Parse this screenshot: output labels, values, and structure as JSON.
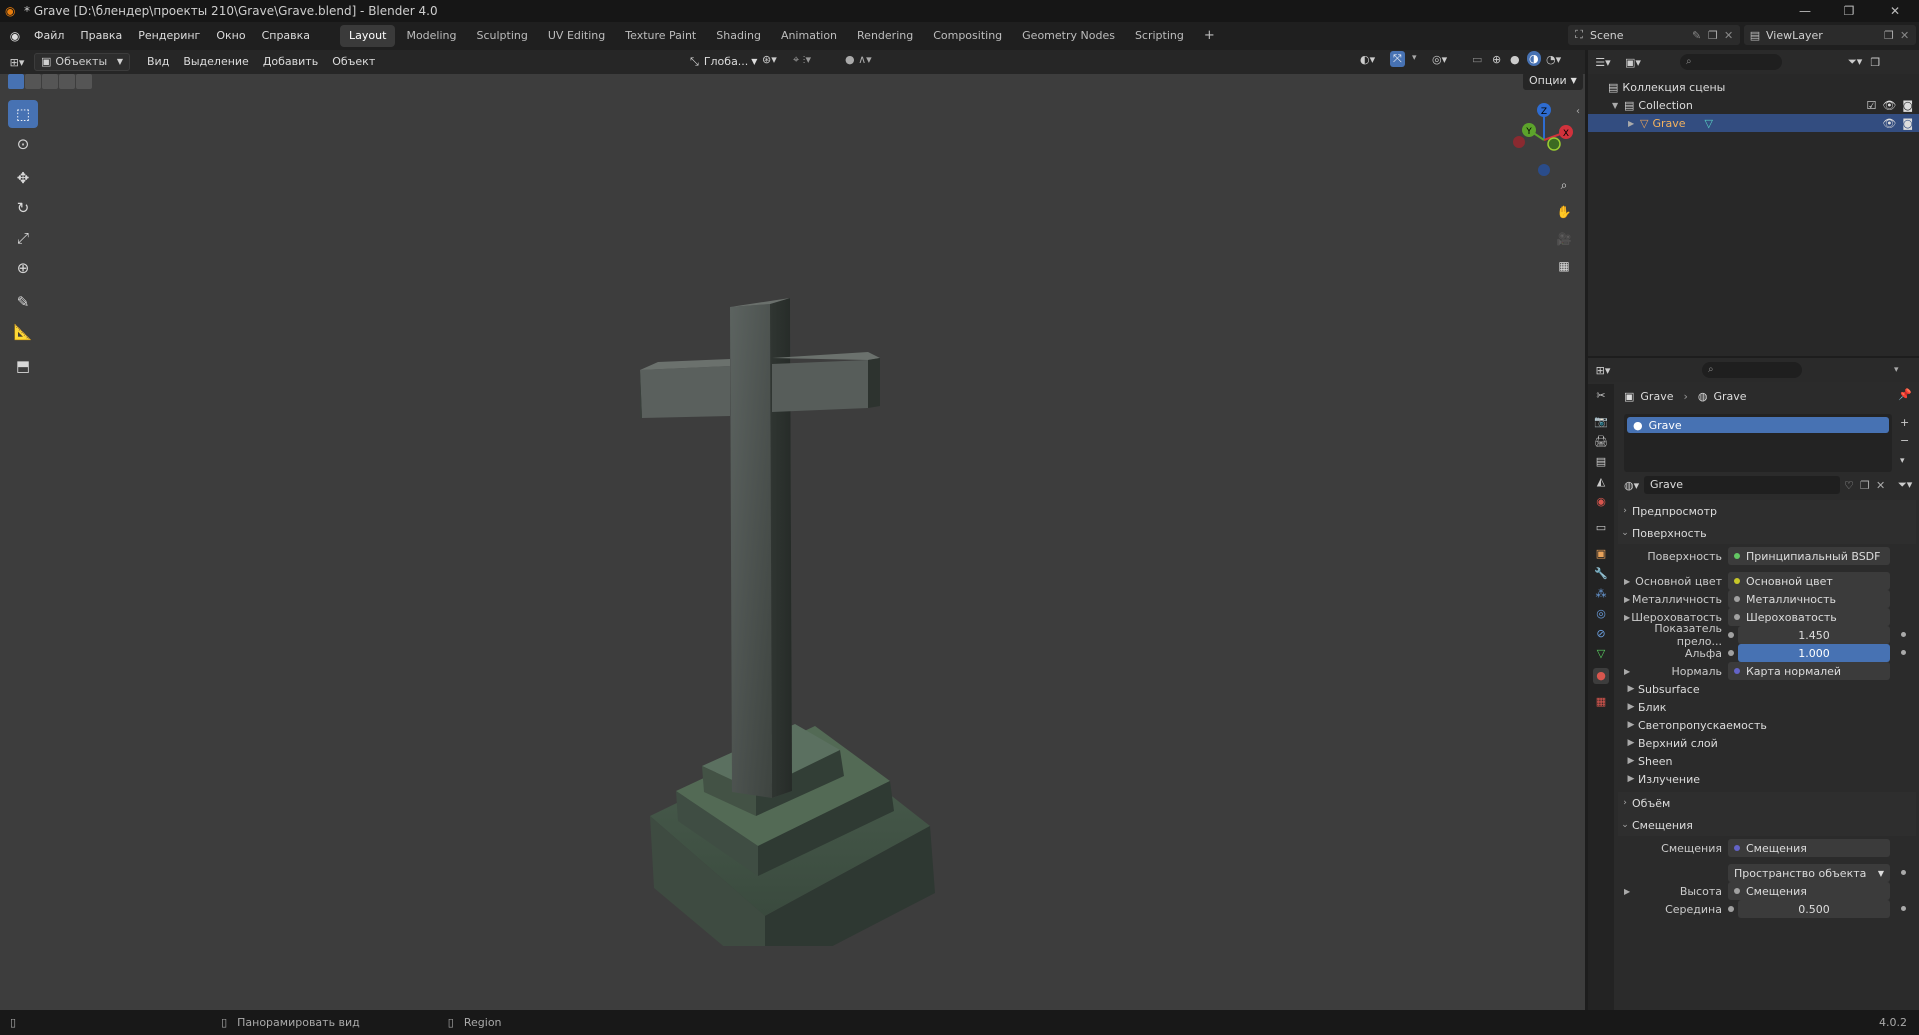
{
  "window": {
    "title": "* Grave [D:\\блендер\\проекты 210\\Grave\\Grave.blend] - Blender 4.0"
  },
  "menu": [
    "Файл",
    "Правка",
    "Рендеринг",
    "Окно",
    "Справка"
  ],
  "workspaces": [
    "Layout",
    "Modeling",
    "Sculpting",
    "UV Editing",
    "Texture Paint",
    "Shading",
    "Animation",
    "Rendering",
    "Compositing",
    "Geometry Nodes",
    "Scripting"
  ],
  "active_workspace": "Layout",
  "scene": {
    "name": "Scene",
    "view_layer": "ViewLayer"
  },
  "viewport_header": {
    "mode": "Объекты",
    "menus": [
      "Вид",
      "Выделение",
      "Добавить",
      "Объект"
    ],
    "orientation": "Глоба...",
    "options": "Опции"
  },
  "outliner": {
    "scene_collection": "Коллекция сцены",
    "collection": "Collection",
    "object": "Grave"
  },
  "properties": {
    "breadcrumb_object": "Grave",
    "breadcrumb_material": "Grave",
    "slot_name": "Grave",
    "material_name": "Grave",
    "panels": {
      "preview": "Предпросмотр",
      "surface": "Поверхность",
      "volume": "Объём",
      "displacement": "Смещения"
    },
    "rows": {
      "surface_label": "Поверхность",
      "surface_value": "Принципиальный BSDF",
      "base_color_label": "Основной цвет",
      "base_color_value": "Основной цвет",
      "metallic_label": "Металличность",
      "metallic_value": "Металличность",
      "roughness_label": "Шероховатость",
      "roughness_value": "Шероховатость",
      "ior_label": "Показатель прело...",
      "ior_value": "1.450",
      "alpha_label": "Альфа",
      "alpha_value": "1.000",
      "normal_label": "Нормаль",
      "normal_value": "Карта нормалей"
    },
    "subpanels": [
      "Subsurface",
      "Блик",
      "Светопропускаемость",
      "Верхний слой",
      "Sheen",
      "Излучение"
    ],
    "disp": {
      "disp_label": "Смещения",
      "disp_value": "Смещения",
      "space_value": "Пространство объекта",
      "height_label": "Высота",
      "height_value": "Смещения",
      "mid_label": "Середина",
      "mid_value": "0.500"
    }
  },
  "status": {
    "pan": "Панорамировать вид",
    "region": "Region",
    "version": "4.0.2"
  },
  "colors": {
    "accent": "#4772b3",
    "selected_row": "#334d80"
  },
  "icons": {
    "mode": "cube-icon",
    "pan": "hand-icon",
    "zoom": "zoom-icon"
  }
}
